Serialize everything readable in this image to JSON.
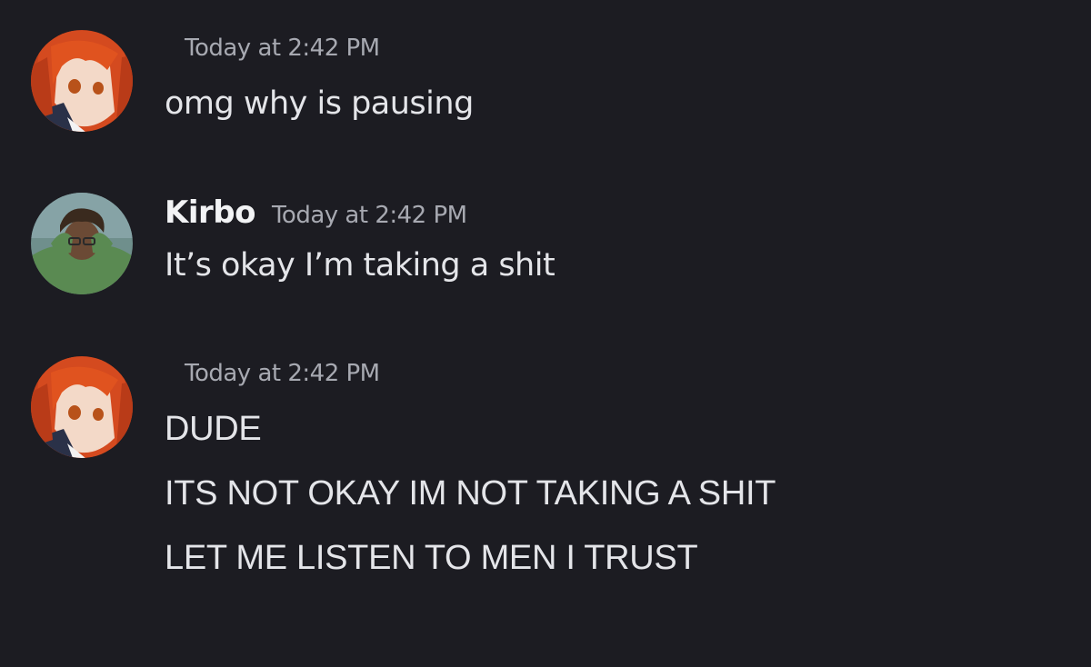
{
  "messages": [
    {
      "author": "",
      "avatar_icon": "anime-girl-red-hair-avatar",
      "timestamp": "Today at 2:42 PM",
      "lines": [
        "omg why is pausing"
      ]
    },
    {
      "author": "Kirbo",
      "avatar_icon": "man-green-shirt-avatar",
      "timestamp": "Today at 2:42 PM",
      "lines": [
        "It’s okay I’m taking a shit"
      ]
    },
    {
      "author": "",
      "avatar_icon": "anime-girl-red-hair-avatar",
      "timestamp": "Today at 2:42 PM",
      "lines": [
        "DUDE",
        "ITS NOT OKAY IM NOT TAKING A SHIT",
        "LET ME LISTEN TO MEN I TRUST"
      ]
    }
  ],
  "colors": {
    "background": "#1c1c22",
    "author": "#f2f3f5",
    "timestamp": "#a7a9b1",
    "message_text": "#e4e5e9"
  }
}
